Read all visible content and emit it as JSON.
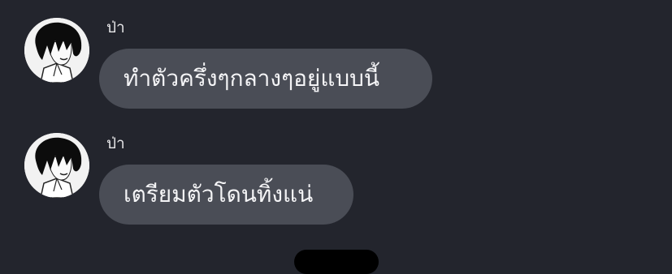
{
  "messages": [
    {
      "sender": "ป่า",
      "text": "ทำตัวครึ่งๆกลางๆอยู่แบบนี้",
      "avatar_icon": "user-avatar-icon"
    },
    {
      "sender": "ป่า",
      "text": "เตรียมตัวโดนทิ้งแน่",
      "avatar_icon": "user-avatar-icon"
    }
  ],
  "colors": {
    "background": "#23252d",
    "bubble": "#4a4d56",
    "text": "#f4f4f6"
  }
}
